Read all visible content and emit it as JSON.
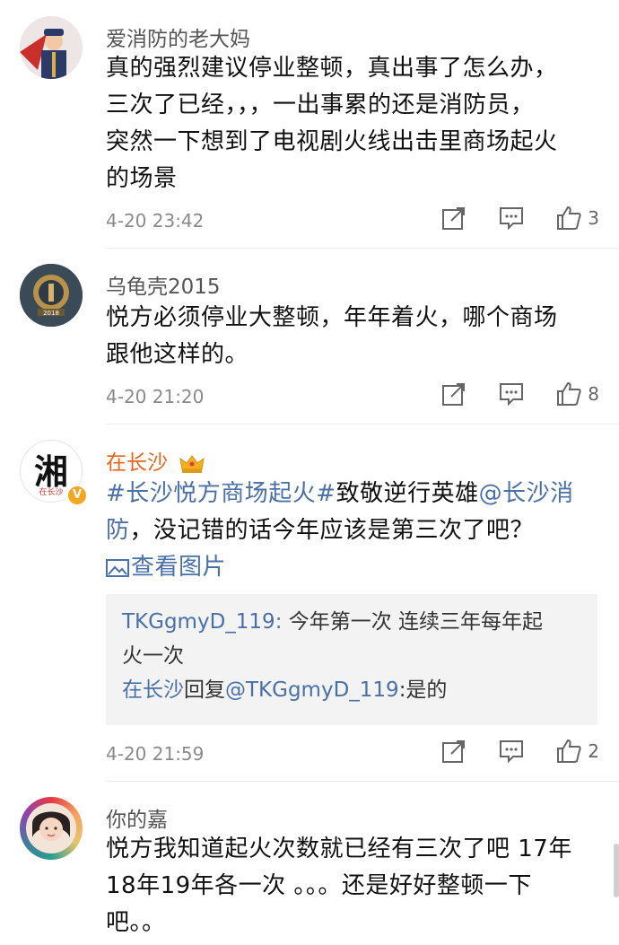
{
  "comments": [
    {
      "username": "爱消防的老大妈",
      "text_lines": [
        "真的强烈建议停业整顿，真出事了怎么办，",
        "三次了已经，，，一出事累的还是消防员，",
        "突然一下想到了电视剧火线出击里商场起火",
        "的场景"
      ],
      "time": "4-20 23:42",
      "likes": "3",
      "avatar_icon": "firefighter-avatar-icon"
    },
    {
      "username": "乌龟壳2015",
      "text_lines": [
        "悦方必须停业大整顿，年年着火，哪个商场",
        "跟他这样的。"
      ],
      "time": "4-20 21:20",
      "likes": "8",
      "avatar_icon": "badge-2018-avatar-icon"
    },
    {
      "username": "在长沙",
      "hashtag": "#长沙悦方商场起火#",
      "text_mid": "致敬逆行英雄",
      "mention_line1": "@长沙消",
      "mention_line2": "防",
      "text_after": "，没记错的话今年应该是第三次了吧？",
      "view_image": "查看图片",
      "replies": [
        {
          "user": "TKGgmyD_119",
          "colon": ":",
          "text_line1": " 今年第一次 连续三年每年起",
          "text_line2": "火一次"
        },
        {
          "user": "在长沙",
          "reply_word": "回复",
          "target": "@TKGgmyD_119",
          "text": ":是的"
        }
      ],
      "time": "4-20 21:59",
      "likes": "2",
      "avatar_text": "湘",
      "avatar_sub": "在长沙",
      "verified": "V"
    },
    {
      "username": "你的嘉",
      "text_lines": [
        "悦方我知道起火次数就已经有三次了吧 17年",
        "18年19年各一次 。。。还是好好整顿一下",
        "吧。。"
      ],
      "avatar_icon": "portrait-avatar-icon"
    }
  ],
  "colors": {
    "link": "#4a70a8",
    "meta": "#8a8a8a",
    "reply_bg": "#f3f3f4"
  }
}
